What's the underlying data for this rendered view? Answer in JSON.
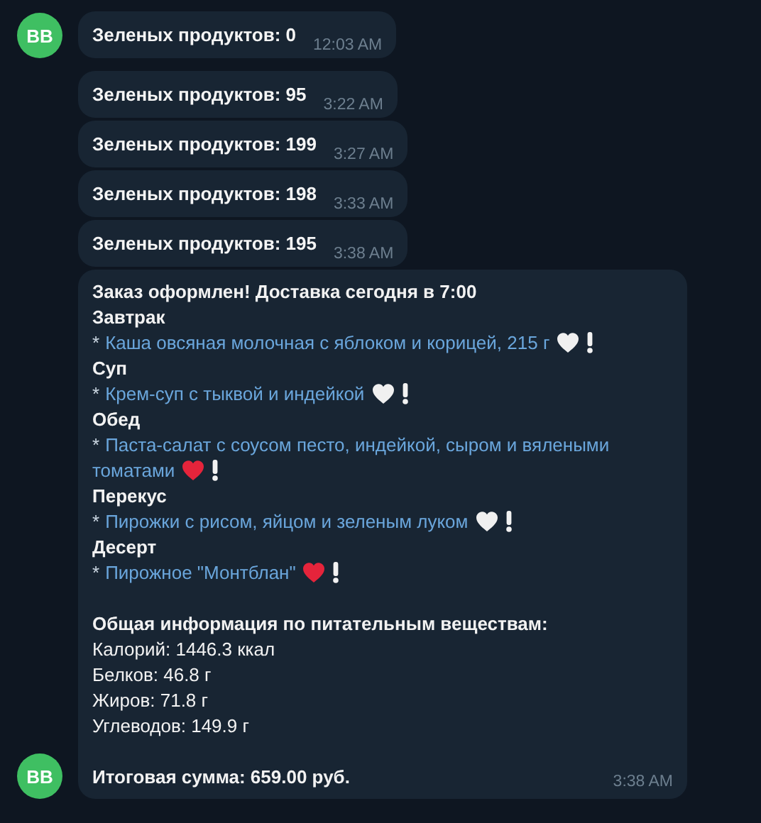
{
  "messages": [
    {
      "avatar": "BB",
      "text": "Зеленых продуктов: 0",
      "time": "12:03 AM"
    },
    {
      "text": "Зеленых продуктов: 95",
      "time": "3:22 AM"
    },
    {
      "text": "Зеленых продуктов: 199",
      "time": "3:27 AM"
    },
    {
      "text": "Зеленых продуктов: 198",
      "time": "3:33 AM"
    },
    {
      "text": "Зеленых продуктов: 195",
      "time": "3:38 AM"
    }
  ],
  "order": {
    "avatar": "BB",
    "time": "3:38 AM",
    "lines": [
      {
        "kind": "heading",
        "text": "Заказ оформлен! Доставка сегодня в 7:00"
      },
      {
        "kind": "section",
        "text": "Завтрак"
      },
      {
        "kind": "item",
        "bullet": "*",
        "text": "Каша овсяная молочная с яблоком и корицей, 215 г",
        "color": "#f0f0f0"
      },
      {
        "kind": "section",
        "text": "Суп"
      },
      {
        "kind": "item",
        "bullet": "*",
        "text": "Крем-суп с тыквой и индейкой",
        "color": "#f0f0f0"
      },
      {
        "kind": "section",
        "text": "Обед"
      },
      {
        "kind": "item",
        "bullet": "*",
        "text": "Паста-салат с соусом песто, индейкой, сыром и вялеными"
      },
      {
        "kind": "continuation",
        "text": "томатами",
        "color": "#e5243b"
      },
      {
        "kind": "section",
        "text": "Перекус"
      },
      {
        "kind": "item",
        "bullet": "*",
        "text": "Пирожки с рисом, яйцом и зеленым луком",
        "color": "#f0f0f0"
      },
      {
        "kind": "section",
        "text": "Десерт"
      },
      {
        "kind": "item",
        "bullet": "*",
        "text": "Пирожное \"Монтблан\"",
        "color": "#e5243b"
      },
      {
        "kind": "blank"
      },
      {
        "kind": "heading",
        "text": "Общая информация по питательным веществам:"
      },
      {
        "kind": "plain",
        "text": "Калорий: 1446.3 ккал"
      },
      {
        "kind": "plain",
        "text": "Белков: 46.8 г"
      },
      {
        "kind": "plain",
        "text": "Жиров: 71.8 г"
      },
      {
        "kind": "plain",
        "text": "Углеводов: 149.9 г"
      },
      {
        "kind": "blank"
      },
      {
        "kind": "heading",
        "text": "Итоговая сумма: 659.00 руб."
      }
    ]
  }
}
